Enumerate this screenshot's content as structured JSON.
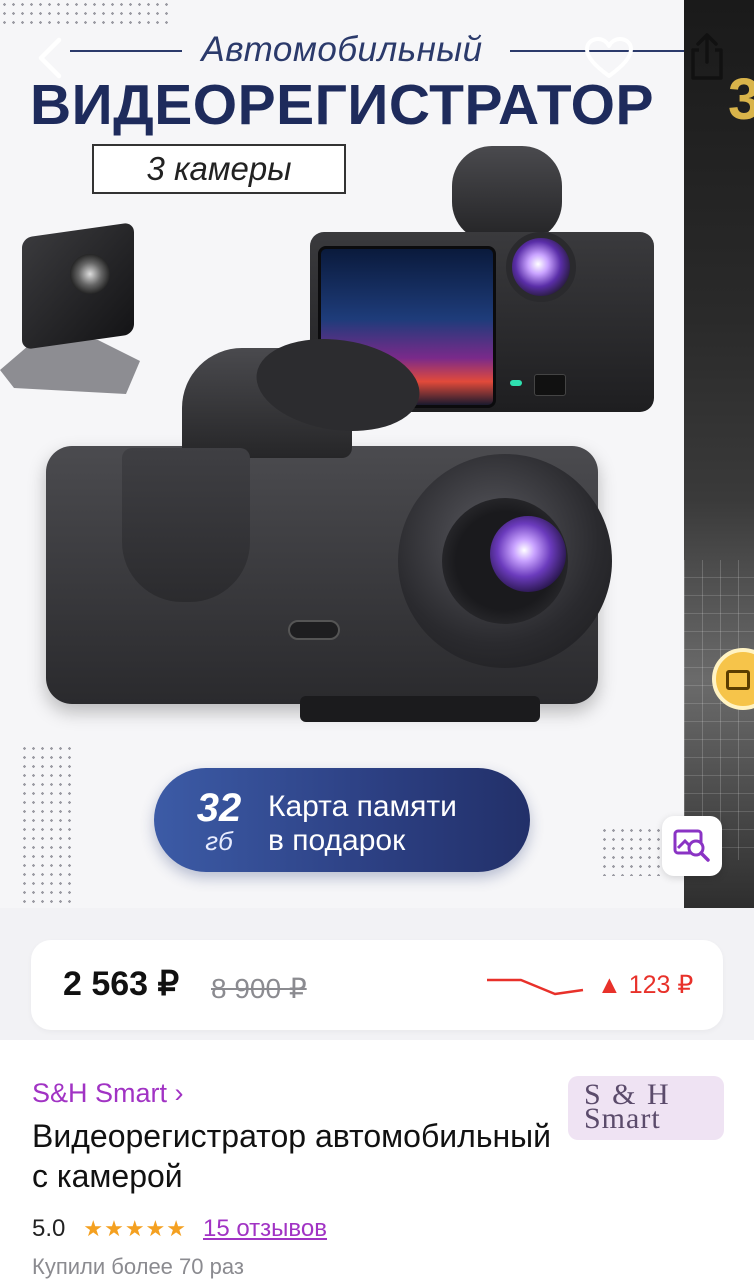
{
  "gallery": {
    "promo_subtitle": "Автомобильный",
    "promo_title": "ВИДЕОРЕГИСТРАТОР",
    "promo_badge": "3 камеры",
    "gift_number": "32",
    "gift_unit": "гб",
    "gift_text_line1": "Карта памяти",
    "gift_text_line2": "в подарок",
    "next_slide_glyph": "3"
  },
  "price": {
    "current": "2 563 ₽",
    "old": "8 900 ₽",
    "change": "▲ 123 ₽",
    "change_color": "#e8312a"
  },
  "product": {
    "brand": "S&H Smart ›",
    "brand_logo_line1": "S & H",
    "brand_logo_line2": "Smart",
    "title": "Видеорегистратор автомобильный с камерой",
    "rating": "5.0",
    "stars": "★★★★★",
    "reviews": "15 отзывов",
    "bought": "Купили более 70 раз"
  },
  "icons": {
    "back": "chevron-left-icon",
    "favorite": "heart-icon",
    "share": "share-icon",
    "image_search": "image-search-icon"
  },
  "colors": {
    "accent": "#a133c4",
    "star": "#f4a020",
    "price_up": "#e8312a",
    "promo_navy": "#1e2b5c"
  }
}
